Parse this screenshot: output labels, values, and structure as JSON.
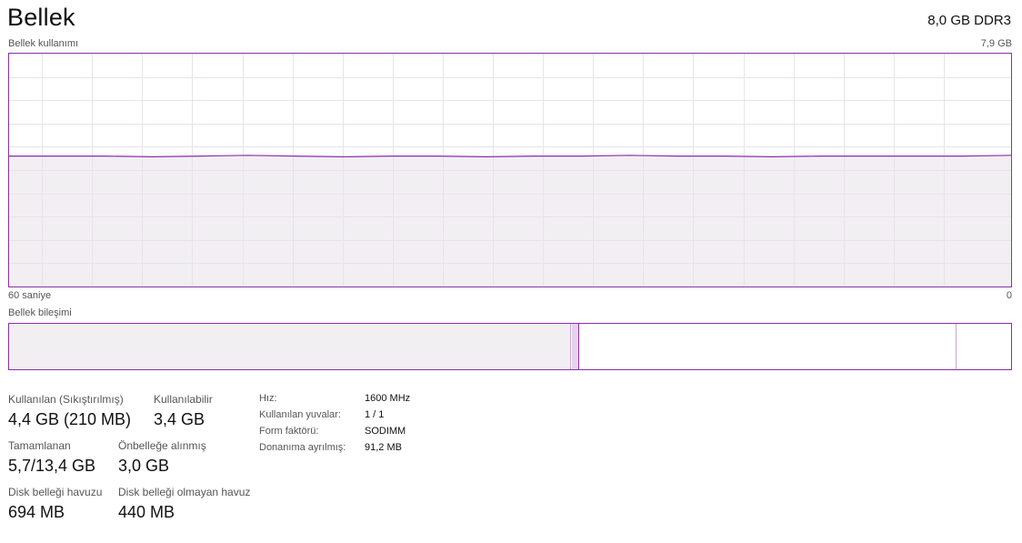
{
  "header": {
    "title": "Bellek",
    "spec": "8,0 GB DDR3"
  },
  "graph": {
    "label": "Bellek kullanımı",
    "max_label": "7,9 GB",
    "axis_left": "60 saniye",
    "axis_right": "0",
    "usage_fraction": 0.56
  },
  "composition": {
    "label": "Bellek bileşimi",
    "used_fraction": 0.561,
    "modified_fraction": 0.008,
    "standby_fraction": 0.376,
    "free_fraction": 0.055
  },
  "stats": [
    {
      "label": "Kullanılan (Sıkıştırılmış)",
      "value": "4,4 GB (210 MB)"
    },
    {
      "label": "Kullanılabilir",
      "value": "3,4 GB"
    },
    {
      "label": "Tamamlanan",
      "value": "5,7/13,4 GB"
    },
    {
      "label": "Önbelleğe alınmış",
      "value": "3,0 GB"
    },
    {
      "label": "Disk belleği havuzu",
      "value": "694 MB"
    },
    {
      "label": "Disk belleği olmayan havuz",
      "value": "440 MB"
    }
  ],
  "details": [
    {
      "label": "Hız:",
      "value": "1600 MHz"
    },
    {
      "label": "Kullanılan yuvalar:",
      "value": "1 / 1"
    },
    {
      "label": "Form faktörü:",
      "value": "SODIMM"
    },
    {
      "label": "Donanıma ayrılmış:",
      "value": "91,2 MB"
    }
  ],
  "colors": {
    "accent": "#8b2fa8",
    "fill": "#f2eff3",
    "grid": "#e8e3ea"
  }
}
